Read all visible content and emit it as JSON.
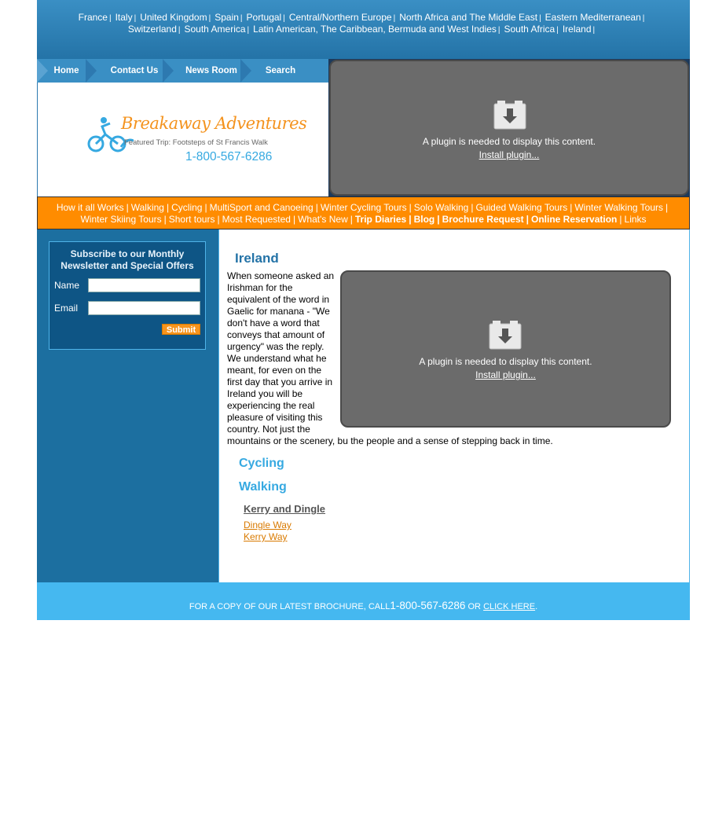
{
  "destinations": {
    "row1": [
      "France",
      "Italy",
      "United Kingdom",
      "Spain",
      "Portugal",
      "Central/Northern Europe",
      "North Africa and The Middle East",
      "Eastern Mediterranean"
    ],
    "row2": [
      "Switzerland",
      "South America",
      "Latin American, The Caribbean, Bermuda and West Indies",
      "South Africa",
      "Ireland"
    ],
    "separator": "|"
  },
  "tabs": {
    "home": "Home",
    "contact": "Contact Us",
    "news": "News Room",
    "search": "Search"
  },
  "logo": {
    "title": "Breakaway Adventures",
    "featured": "Featured Trip: Footsteps of St Francis Walk",
    "phone": "1-800-567-6286"
  },
  "plugin": {
    "message": "A plugin is needed to display this content.",
    "install": "Install plugin..."
  },
  "mainnav": {
    "row1": [
      "How it all Works",
      "Walking",
      "Cycling",
      "MultiSport and Canoeing",
      "Winter Cycling Tours",
      "Solo Walking",
      "Guided Walking Tours",
      "Winter Walking Tours"
    ],
    "row2_normal": [
      "Winter Skiing Tours",
      "Short tours",
      "Most Requested",
      "What's New"
    ],
    "row2_bold": [
      "Trip Diaries",
      "Blog",
      "Brochure Request",
      "Online Reservation"
    ],
    "row2_last": "Links"
  },
  "newsletter": {
    "title": "Subscribe to our Monthly Newsletter and Special Offers",
    "name_label": "Name",
    "email_label": "Email",
    "submit": "Submit"
  },
  "content": {
    "title": "Ireland",
    "intro": "When someone asked an Irishman for the equivalent of the word in Gaelic for manana - \"We don't have a word that conveys that amount of urgency\" was the reply. We understand what he meant, for even on the first day that you arrive in Ireland you will be experiencing the real pleasure of visiting this country.  Not just the",
    "intro_tail": "mountains or the scenery, bu the people and a sense of stepping back in time.",
    "sections": [
      "Cycling",
      "Walking"
    ],
    "subheading": "Kerry and Dingle",
    "links": [
      "Dingle Way",
      "Kerry Way"
    ]
  },
  "footer": {
    "prefix": "FOR A COPY OF OUR LATEST BROCHURE, CALL",
    "phone": "1-800-567-6286",
    "or": " OR ",
    "link": "CLICK HERE",
    "suffix": "."
  },
  "colors": {
    "primary": "#2473a7",
    "accent": "#ff8c00",
    "light_blue": "#45b8f0"
  }
}
